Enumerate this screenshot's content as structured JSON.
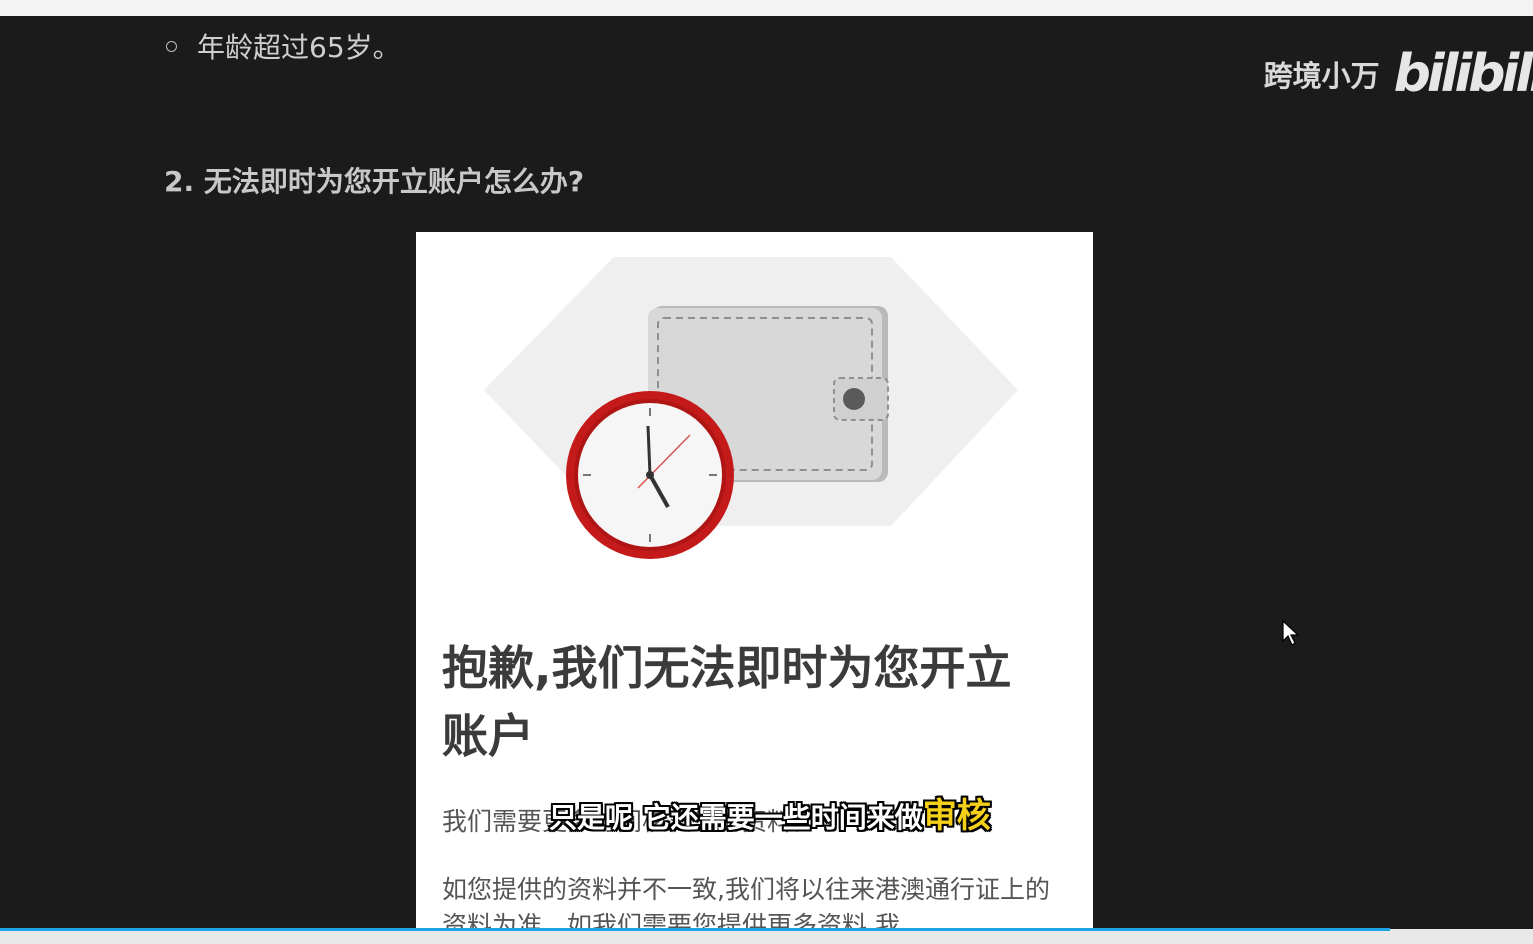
{
  "page": {
    "bullet_text": "年龄超过65岁。",
    "section_heading": "2. 无法即时为您开立账户怎么办?"
  },
  "watermark": {
    "channel": "跨境小万",
    "logo": "bilibili"
  },
  "card": {
    "title": "抱歉,我们无法即时为您开立账户",
    "paragraph1": "我们需要更多时间核实您的资料。",
    "paragraph2": "如您提供的资料并不一致,我们将以往来港澳通行证上的资料为准。如我们需要您提供更多资料,我"
  },
  "subtitle": {
    "text": "只是呢 它还需要一些时间来做",
    "highlight": "审核"
  },
  "colors": {
    "background": "#1b1b1b",
    "clock_rim": "#c41a1a",
    "highlight": "#f5d018",
    "progress": "#1aa4e4"
  },
  "icons": [
    "wallet-icon",
    "clock-icon",
    "mouse-cursor-icon"
  ],
  "video_progress": 0.907
}
